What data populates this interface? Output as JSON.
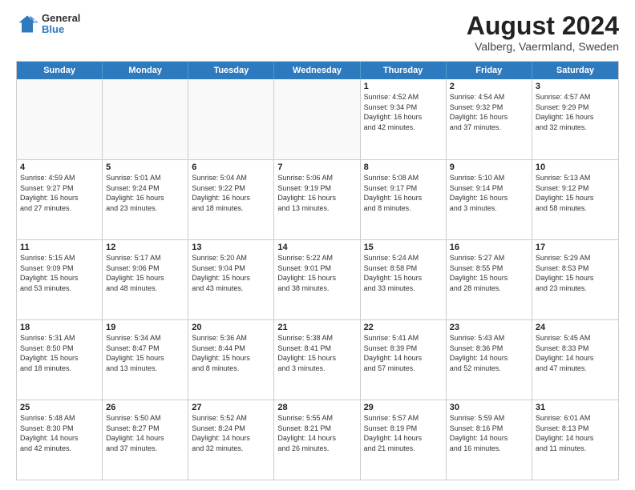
{
  "header": {
    "logo_general": "General",
    "logo_blue": "Blue",
    "month_year": "August 2024",
    "location": "Valberg, Vaermland, Sweden"
  },
  "calendar": {
    "weekdays": [
      "Sunday",
      "Monday",
      "Tuesday",
      "Wednesday",
      "Thursday",
      "Friday",
      "Saturday"
    ],
    "rows": [
      [
        {
          "day": "",
          "text": ""
        },
        {
          "day": "",
          "text": ""
        },
        {
          "day": "",
          "text": ""
        },
        {
          "day": "",
          "text": ""
        },
        {
          "day": "1",
          "text": "Sunrise: 4:52 AM\nSunset: 9:34 PM\nDaylight: 16 hours\nand 42 minutes."
        },
        {
          "day": "2",
          "text": "Sunrise: 4:54 AM\nSunset: 9:32 PM\nDaylight: 16 hours\nand 37 minutes."
        },
        {
          "day": "3",
          "text": "Sunrise: 4:57 AM\nSunset: 9:29 PM\nDaylight: 16 hours\nand 32 minutes."
        }
      ],
      [
        {
          "day": "4",
          "text": "Sunrise: 4:59 AM\nSunset: 9:27 PM\nDaylight: 16 hours\nand 27 minutes."
        },
        {
          "day": "5",
          "text": "Sunrise: 5:01 AM\nSunset: 9:24 PM\nDaylight: 16 hours\nand 23 minutes."
        },
        {
          "day": "6",
          "text": "Sunrise: 5:04 AM\nSunset: 9:22 PM\nDaylight: 16 hours\nand 18 minutes."
        },
        {
          "day": "7",
          "text": "Sunrise: 5:06 AM\nSunset: 9:19 PM\nDaylight: 16 hours\nand 13 minutes."
        },
        {
          "day": "8",
          "text": "Sunrise: 5:08 AM\nSunset: 9:17 PM\nDaylight: 16 hours\nand 8 minutes."
        },
        {
          "day": "9",
          "text": "Sunrise: 5:10 AM\nSunset: 9:14 PM\nDaylight: 16 hours\nand 3 minutes."
        },
        {
          "day": "10",
          "text": "Sunrise: 5:13 AM\nSunset: 9:12 PM\nDaylight: 15 hours\nand 58 minutes."
        }
      ],
      [
        {
          "day": "11",
          "text": "Sunrise: 5:15 AM\nSunset: 9:09 PM\nDaylight: 15 hours\nand 53 minutes."
        },
        {
          "day": "12",
          "text": "Sunrise: 5:17 AM\nSunset: 9:06 PM\nDaylight: 15 hours\nand 48 minutes."
        },
        {
          "day": "13",
          "text": "Sunrise: 5:20 AM\nSunset: 9:04 PM\nDaylight: 15 hours\nand 43 minutes."
        },
        {
          "day": "14",
          "text": "Sunrise: 5:22 AM\nSunset: 9:01 PM\nDaylight: 15 hours\nand 38 minutes."
        },
        {
          "day": "15",
          "text": "Sunrise: 5:24 AM\nSunset: 8:58 PM\nDaylight: 15 hours\nand 33 minutes."
        },
        {
          "day": "16",
          "text": "Sunrise: 5:27 AM\nSunset: 8:55 PM\nDaylight: 15 hours\nand 28 minutes."
        },
        {
          "day": "17",
          "text": "Sunrise: 5:29 AM\nSunset: 8:53 PM\nDaylight: 15 hours\nand 23 minutes."
        }
      ],
      [
        {
          "day": "18",
          "text": "Sunrise: 5:31 AM\nSunset: 8:50 PM\nDaylight: 15 hours\nand 18 minutes."
        },
        {
          "day": "19",
          "text": "Sunrise: 5:34 AM\nSunset: 8:47 PM\nDaylight: 15 hours\nand 13 minutes."
        },
        {
          "day": "20",
          "text": "Sunrise: 5:36 AM\nSunset: 8:44 PM\nDaylight: 15 hours\nand 8 minutes."
        },
        {
          "day": "21",
          "text": "Sunrise: 5:38 AM\nSunset: 8:41 PM\nDaylight: 15 hours\nand 3 minutes."
        },
        {
          "day": "22",
          "text": "Sunrise: 5:41 AM\nSunset: 8:39 PM\nDaylight: 14 hours\nand 57 minutes."
        },
        {
          "day": "23",
          "text": "Sunrise: 5:43 AM\nSunset: 8:36 PM\nDaylight: 14 hours\nand 52 minutes."
        },
        {
          "day": "24",
          "text": "Sunrise: 5:45 AM\nSunset: 8:33 PM\nDaylight: 14 hours\nand 47 minutes."
        }
      ],
      [
        {
          "day": "25",
          "text": "Sunrise: 5:48 AM\nSunset: 8:30 PM\nDaylight: 14 hours\nand 42 minutes."
        },
        {
          "day": "26",
          "text": "Sunrise: 5:50 AM\nSunset: 8:27 PM\nDaylight: 14 hours\nand 37 minutes."
        },
        {
          "day": "27",
          "text": "Sunrise: 5:52 AM\nSunset: 8:24 PM\nDaylight: 14 hours\nand 32 minutes."
        },
        {
          "day": "28",
          "text": "Sunrise: 5:55 AM\nSunset: 8:21 PM\nDaylight: 14 hours\nand 26 minutes."
        },
        {
          "day": "29",
          "text": "Sunrise: 5:57 AM\nSunset: 8:19 PM\nDaylight: 14 hours\nand 21 minutes."
        },
        {
          "day": "30",
          "text": "Sunrise: 5:59 AM\nSunset: 8:16 PM\nDaylight: 14 hours\nand 16 minutes."
        },
        {
          "day": "31",
          "text": "Sunrise: 6:01 AM\nSunset: 8:13 PM\nDaylight: 14 hours\nand 11 minutes."
        }
      ]
    ]
  }
}
